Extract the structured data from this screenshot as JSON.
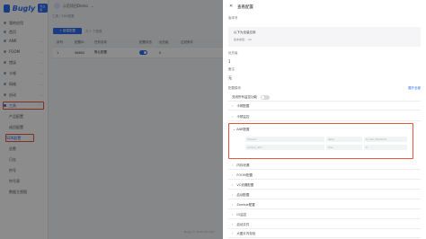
{
  "sidebar": {
    "logo": "Bugly",
    "badge": "专业版",
    "items": [
      {
        "label": "我的应用"
      },
      {
        "label": "首页"
      },
      {
        "label": "ANR"
      },
      {
        "label": "FOOM"
      },
      {
        "label": "错误"
      },
      {
        "label": "卡顿"
      },
      {
        "label": "网络"
      },
      {
        "label": "启动"
      },
      {
        "label": "工具"
      }
    ],
    "sub_items": [
      {
        "label": "产品配置"
      },
      {
        "label": "成员配置"
      },
      {
        "label": "SDK配置"
      },
      {
        "label": "告警"
      },
      {
        "label": "日志"
      },
      {
        "label": "符号"
      },
      {
        "label": "符号表"
      },
      {
        "label": "数据主视图"
      }
    ]
  },
  "header": {
    "app_name": "示范项目Demo",
    "breadcrumb": "工具 / SDK配置"
  },
  "toolbar": {
    "add_label": "+ 新建配置",
    "count_text": "共 1 个配置"
  },
  "table": {
    "columns": [
      "序号",
      "配置ID",
      "任务名称",
      "配置状态",
      "优先级",
      "过滤条件"
    ],
    "rows": [
      {
        "index": "1",
        "id": "56892",
        "name": "默认配置",
        "status_on": true,
        "priority": "0",
        "filter": ""
      }
    ]
  },
  "footer": "Bugly © 2024 Tencent",
  "panel": {
    "title": "查看配置",
    "field_source": "版本号",
    "box_line1": "以下为全量应用",
    "box_line2_label": "版本类型：",
    "box_line2_value": "All",
    "field_priority": "优先级",
    "priority_value": "1",
    "field_desc": "备注",
    "desc_value": "无",
    "field_modules": "配置模块",
    "expand_all": "展开全部",
    "switch_label": "关闭所有监控功能",
    "modules_top": [
      "卡顿配置",
      "卡顿监控"
    ],
    "amp_title": "ANR配置",
    "amp_inputs": [
      "timeout",
      "delay",
      "fd_max_threshold",
      "sample_ratio",
      "true",
      "0"
    ],
    "modules_bottom": [
      "内存泄漏",
      "FOOM配置",
      "VC泄漏配置",
      "启动配置",
      "Zombie配置",
      "IO监控",
      "启动文件",
      "大图片内存检"
    ]
  }
}
